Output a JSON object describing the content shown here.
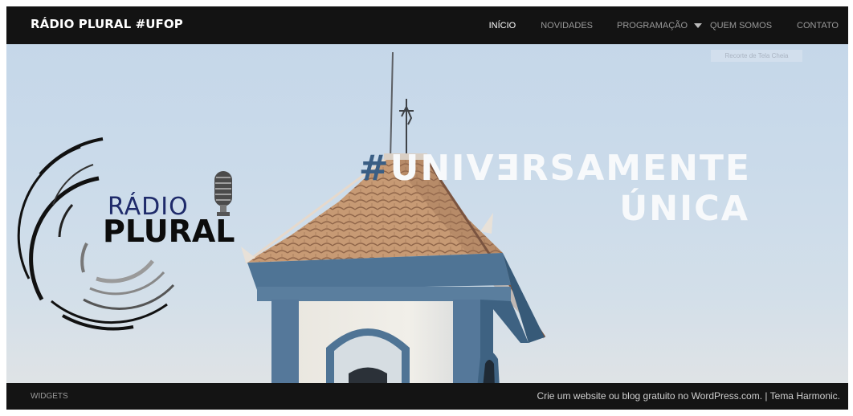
{
  "site": {
    "title": "RÁDIO PLURAL #UFOP"
  },
  "nav": {
    "items": [
      {
        "label": "INÍCIO"
      },
      {
        "label": "NOVIDADES"
      },
      {
        "label": "PROGRAMAÇÃO"
      },
      {
        "label": "QUEM SOMOS"
      },
      {
        "label": "CONTATO"
      }
    ]
  },
  "hero": {
    "tooltip": "Recorte de Tela Cheia",
    "tagline": {
      "hash": "#",
      "line1": "UNIVƎRSAMENTE",
      "line2": "ÚNICA"
    },
    "logo": {
      "radio": "RÁDIO",
      "plural": "PLURAL"
    }
  },
  "footer": {
    "widgets": "WIDGETS",
    "credit_wordpress": "Crie um website ou blog gratuito no WordPress.com.",
    "separator": "|",
    "credit_theme": "Tema Harmonic."
  },
  "colors": {
    "topbar": "#131313",
    "footer": "#141414",
    "sky": "#c9d9ea",
    "tower_blue": "#4f7495",
    "roof": "#c79a74",
    "hash_blue": "#3a5e84"
  },
  "icons": [
    "microphone-icon",
    "chevron-down-icon"
  ]
}
